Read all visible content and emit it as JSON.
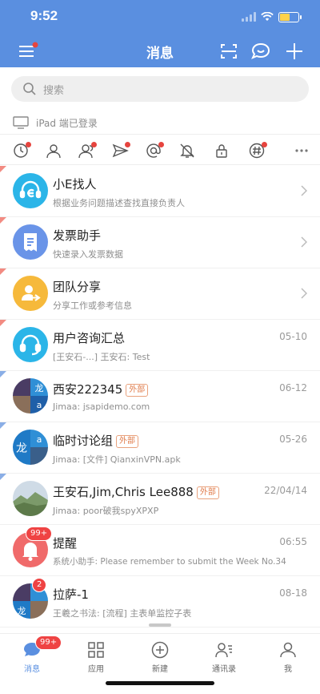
{
  "status": {
    "time": "9:52"
  },
  "header": {
    "title": "消息",
    "menu_icon": "menu-icon",
    "scan_icon": "scan-icon",
    "chat_icon": "chat-bubble-icon",
    "add_icon": "plus-icon"
  },
  "search": {
    "placeholder": "搜索"
  },
  "device_notice": "iPad 端已登录",
  "filters": [
    "clock-icon",
    "person-icon",
    "group-icon",
    "send-icon",
    "at-icon",
    "bell-off-icon",
    "lock-icon",
    "hashtag-icon",
    "more-icon"
  ],
  "conversations": [
    {
      "title": "小E找人",
      "subtitle": "根据业务问题描述查找直接负责人",
      "date": "",
      "icon": "headset-e-icon",
      "color": "#2bb5e8"
    },
    {
      "title": "发票助手",
      "subtitle": "快速录入发票数据",
      "date": "",
      "icon": "receipt-icon",
      "color": "#6a94e8"
    },
    {
      "title": "团队分享",
      "subtitle": "分享工作或参考信息",
      "date": "",
      "icon": "share-person-icon",
      "color": "#f6b93b"
    },
    {
      "title": "用户咨询汇总",
      "subtitle": "[王安石-...] 王安石: Test",
      "date": "05-10",
      "icon": "headset-icon",
      "color": "#2bb5e8"
    },
    {
      "title": "西安222345",
      "tag": "外部",
      "subtitle": "Jimaa: jsapidemo.com",
      "date": "06-12",
      "icon": "group-avatar-icon",
      "color": "#3a5f8a"
    },
    {
      "title": "临时讨论组",
      "tag": "外部",
      "subtitle": "Jimaa: [文件] QianxinVPN.apk",
      "date": "05-26",
      "icon": "group-avatar-icon",
      "color": "#1f7ac6"
    },
    {
      "title": "王安石,Jim,Chris Lee888",
      "tag": "外部",
      "subtitle": "Jimaa: poor破我spyXPXP",
      "date": "22/04/14",
      "icon": "landscape-avatar-icon",
      "color": "#7c9a6a"
    },
    {
      "title": "提醒",
      "subtitle": "系统小助手: Please remember to submit the Week No.34",
      "date": "06:55",
      "icon": "bell-icon",
      "color": "#f06a6a",
      "badge": "99+"
    },
    {
      "title": "拉萨-1",
      "subtitle": "王羲之书法: [流程] 主表单监控子表",
      "date": "08-18",
      "icon": "group-avatar-icon",
      "color": "#3a5f8a",
      "badge": "2"
    }
  ],
  "tabs": [
    {
      "label": "消息",
      "icon": "message-icon",
      "badge": "99+",
      "active": true
    },
    {
      "label": "应用",
      "icon": "apps-grid-icon"
    },
    {
      "label": "新建",
      "icon": "plus-circle-icon"
    },
    {
      "label": "通讯录",
      "icon": "contacts-icon"
    },
    {
      "label": "我",
      "icon": "user-icon"
    }
  ],
  "colors": {
    "brand": "#5a8fe0",
    "badge": "#ef4343",
    "tag": "#e07b4a"
  }
}
